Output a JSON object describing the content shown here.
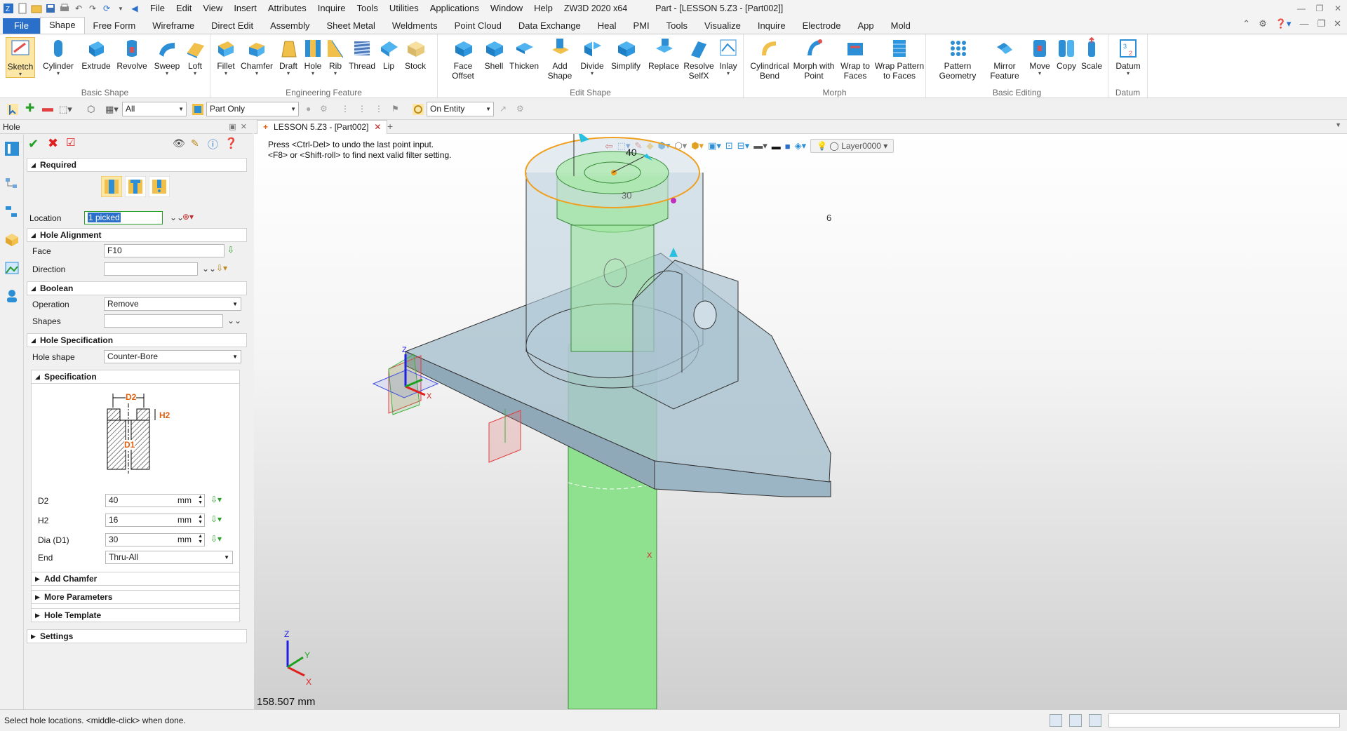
{
  "app": {
    "title_app": "ZW3D 2020 x64",
    "title_doc": "Part - [LESSON 5.Z3 - [Part002]]"
  },
  "menubar": [
    "File",
    "Edit",
    "View",
    "Insert",
    "Attributes",
    "Inquire",
    "Tools",
    "Utilities",
    "Applications",
    "Window",
    "Help"
  ],
  "ribbon_tabs": [
    "File",
    "Shape",
    "Free Form",
    "Wireframe",
    "Direct Edit",
    "Assembly",
    "Sheet Metal",
    "Weldments",
    "Point Cloud",
    "Data Exchange",
    "Heal",
    "PMI",
    "Tools",
    "Visualize",
    "Inquire",
    "Electrode",
    "App",
    "Mold"
  ],
  "ribbon": {
    "basic_shape": {
      "label": "Basic Shape",
      "buttons": [
        "Sketch",
        "Cylinder",
        "Extrude",
        "Revolve",
        "Sweep",
        "Loft"
      ]
    },
    "engineering": {
      "label": "Engineering Feature",
      "buttons": [
        "Fillet",
        "Chamfer",
        "Draft",
        "Hole",
        "Rib",
        "Thread",
        "Lip",
        "Stock"
      ]
    },
    "edit_shape": {
      "label": "Edit Shape",
      "buttons": [
        "Face\nOffset",
        "Shell",
        "Thicken",
        "Add\nShape",
        "Divide",
        "Simplify",
        "Replace",
        "Resolve\nSelfX",
        "Inlay"
      ]
    },
    "morph": {
      "label": "Morph",
      "buttons": [
        "Cylindrical\nBend",
        "Morph with\nPoint",
        "Wrap to\nFaces",
        "Wrap Pattern\nto Faces"
      ]
    },
    "basic_editing": {
      "label": "Basic Editing",
      "buttons": [
        "Pattern\nGeometry",
        "Mirror\nFeature",
        "Move",
        "Copy",
        "Scale"
      ]
    },
    "datum": {
      "label": "Datum",
      "buttons": [
        "Datum"
      ]
    }
  },
  "cmdbar": {
    "filter": "All",
    "scope": "Part Only",
    "snap": "On Entity"
  },
  "panel": {
    "title": "Hole",
    "required": {
      "label": "Required",
      "location_label": "Location",
      "location_value": "1 picked"
    },
    "alignment": {
      "label": "Hole Alignment",
      "face_label": "Face",
      "face_value": "F10",
      "direction_label": "Direction",
      "direction_value": ""
    },
    "boolean": {
      "label": "Boolean",
      "operation_label": "Operation",
      "operation_value": "Remove",
      "shapes_label": "Shapes",
      "shapes_value": ""
    },
    "spec": {
      "label": "Hole Specification",
      "shape_label": "Hole shape",
      "shape_value": "Counter-Bore",
      "sub_label": "Specification",
      "diagram": {
        "d2": "D2",
        "h2": "H2",
        "d1": "D1"
      },
      "d2_label": "D2",
      "d2_value": "40",
      "h2_label": "H2",
      "h2_value": "16",
      "dia_label": "Dia (D1)",
      "dia_value": "30",
      "unit": "mm",
      "end_label": "End",
      "end_value": "Thru-All"
    },
    "collapsed": [
      "Add Chamfer",
      "More Parameters",
      "Hole Template"
    ],
    "settings": "Settings"
  },
  "doc_tab": "LESSON 5.Z3 - [Part002]",
  "viewport": {
    "prompt_line1": "Press <Ctrl-Del> to undo the last point input.",
    "prompt_line2": "<F8> or <Shift-roll> to find next valid filter setting.",
    "layer": "Layer0000",
    "dim_40": "40",
    "dim_30": "30",
    "dim_6": "6",
    "readout": "158.507 mm",
    "axis_x": "X",
    "axis_y": "Y",
    "axis_z": "Z"
  },
  "status": {
    "text": "Select hole locations. <middle-click> when done."
  },
  "colors": {
    "accent": "#2a6fc9",
    "solid_green": "#8fe08f",
    "transparent_body": "#9fb8c8",
    "highlight": "#f0a020"
  }
}
